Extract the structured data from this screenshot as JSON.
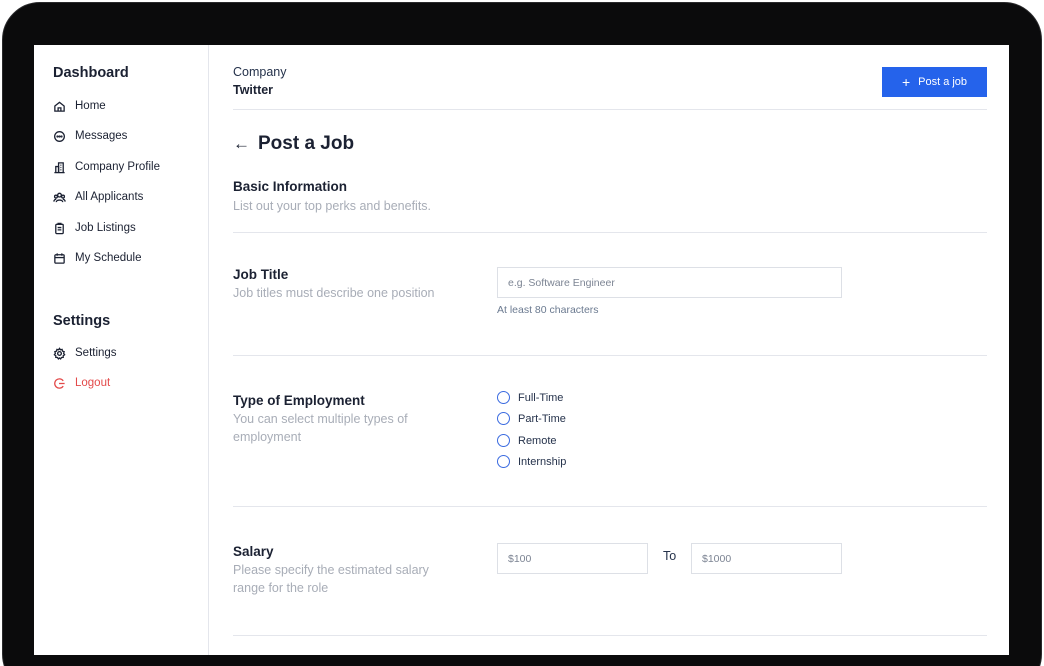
{
  "sidebar": {
    "dashboard_heading": "Dashboard",
    "items": [
      {
        "label": "Home",
        "icon": "home-icon"
      },
      {
        "label": "Messages",
        "icon": "message-icon"
      },
      {
        "label": "Company Profile",
        "icon": "building-icon"
      },
      {
        "label": "All Applicants",
        "icon": "users-icon"
      },
      {
        "label": "Job Listings",
        "icon": "clipboard-icon"
      },
      {
        "label": "My Schedule",
        "icon": "calendar-icon"
      }
    ],
    "settings_heading": "Settings",
    "settings_items": [
      {
        "label": "Settings",
        "icon": "gear-icon"
      },
      {
        "label": "Logout",
        "icon": "logout-icon"
      }
    ]
  },
  "header": {
    "company_label": "Company",
    "company_name": "Twitter",
    "post_button": "Post a job"
  },
  "page": {
    "title": "Post a Job",
    "basic_info": {
      "title": "Basic Information",
      "desc": "List out your top perks and benefits."
    },
    "job_title": {
      "title": "Job Title",
      "desc": "Job titles must describe one position",
      "placeholder": "e.g. Software Engineer",
      "hint": "At least 80 characters"
    },
    "employment": {
      "title": "Type of Employment",
      "desc": "You can select multiple types of employment",
      "options": [
        "Full-Time",
        "Part-Time",
        "Remote",
        "Internship"
      ]
    },
    "salary": {
      "title": "Salary",
      "desc": "Please specify the estimated salary range for the role",
      "min_placeholder": "$100",
      "to_label": "To",
      "max_placeholder": "$1000"
    }
  },
  "colors": {
    "accent": "#2563EB",
    "logout": "#E34A4A",
    "muted_text": "#A8ADB7"
  }
}
